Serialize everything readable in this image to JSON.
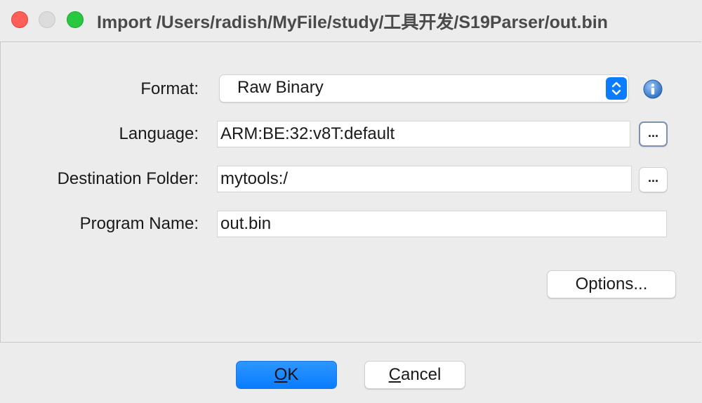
{
  "window": {
    "title": "Import /Users/radish/MyFile/study/工具开发/S19Parser/out.bin"
  },
  "form": {
    "format_label": "Format:",
    "format_value": "Raw Binary",
    "language_label": "Language:",
    "language_value": "ARM:BE:32:v8T:default",
    "destination_label": "Destination Folder:",
    "destination_value": "mytools:/",
    "program_name_label": "Program Name:",
    "program_name_value": "out.bin",
    "browse_label": "...",
    "options_label": "Options..."
  },
  "buttons": {
    "ok_mnemonic": "O",
    "ok_rest": "K",
    "cancel_mnemonic": "C",
    "cancel_rest": "ancel"
  },
  "colors": {
    "accent": "#0a7cff",
    "close": "#fe5f57",
    "maximize": "#28c840",
    "info": "#3d7fd4"
  },
  "icons": [
    "close-icon",
    "minimize-icon",
    "maximize-icon",
    "select-arrows-icon",
    "info-icon"
  ]
}
